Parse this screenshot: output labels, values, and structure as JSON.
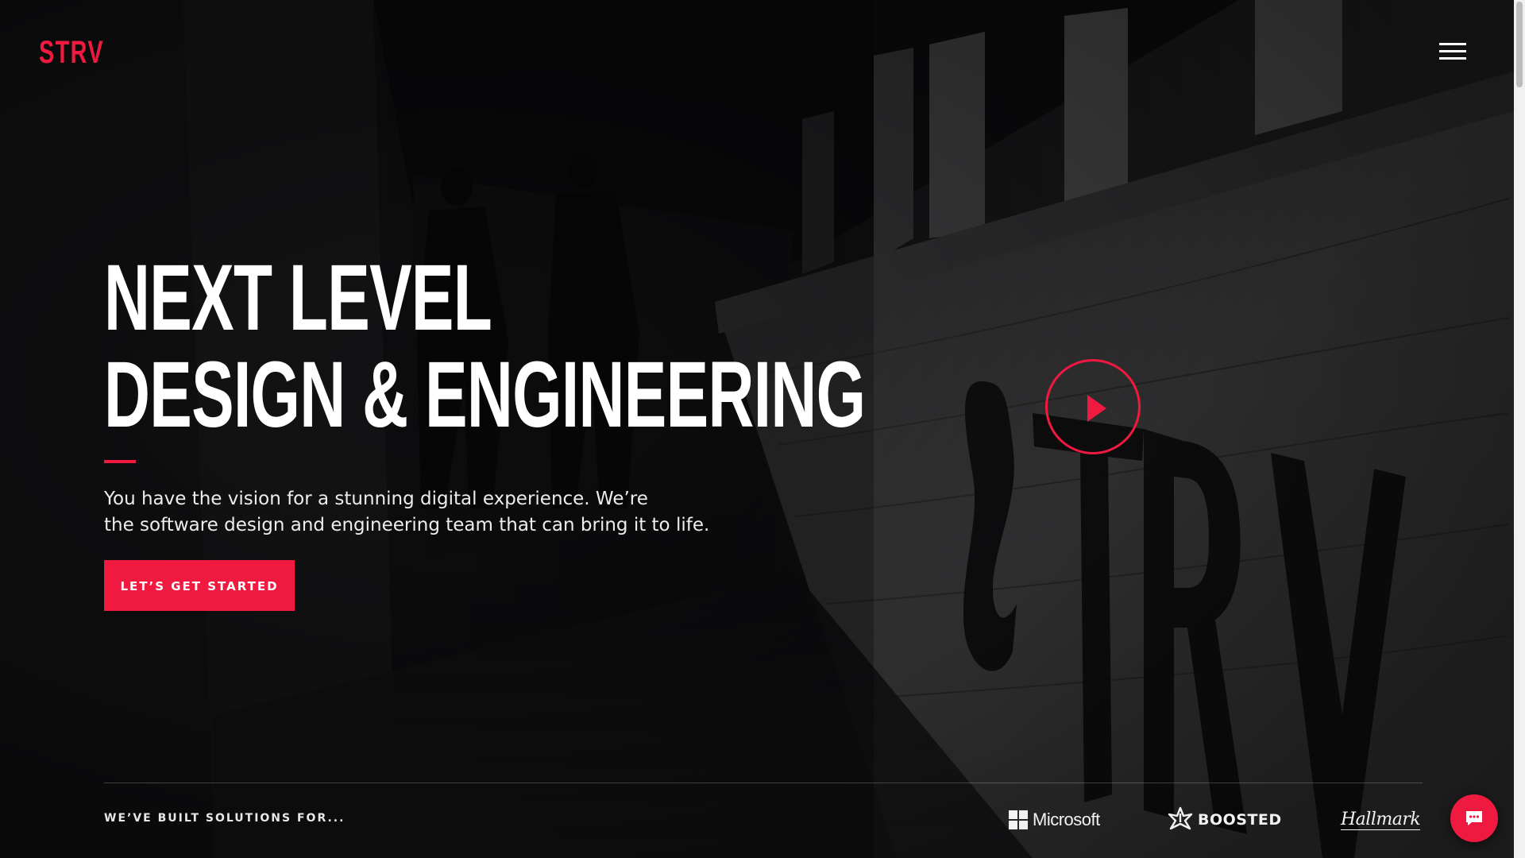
{
  "brand": {
    "name": "STRV",
    "accent_color": "#f0193f"
  },
  "header": {
    "menu_icon": "hamburger-menu-icon"
  },
  "hero": {
    "title_line_1": "NEXT LEVEL",
    "title_line_2": "DESIGN & ENGINEERING",
    "copy_line_1": "You have the vision for a stunning digital experience. We’re",
    "copy_line_2": "the software design and engineering team that can bring it to life.",
    "cta_label": "LET’S GET STARTED",
    "play_icon": "play-icon",
    "background_sign_text": "STRV"
  },
  "clients": {
    "label": "WE’VE BUILT SOLUTIONS FOR...",
    "logos": [
      {
        "name": "Microsoft"
      },
      {
        "name": "BOOSTED"
      },
      {
        "name": "Hallmark"
      }
    ]
  },
  "chat": {
    "icon": "chat-bubble-icon"
  }
}
